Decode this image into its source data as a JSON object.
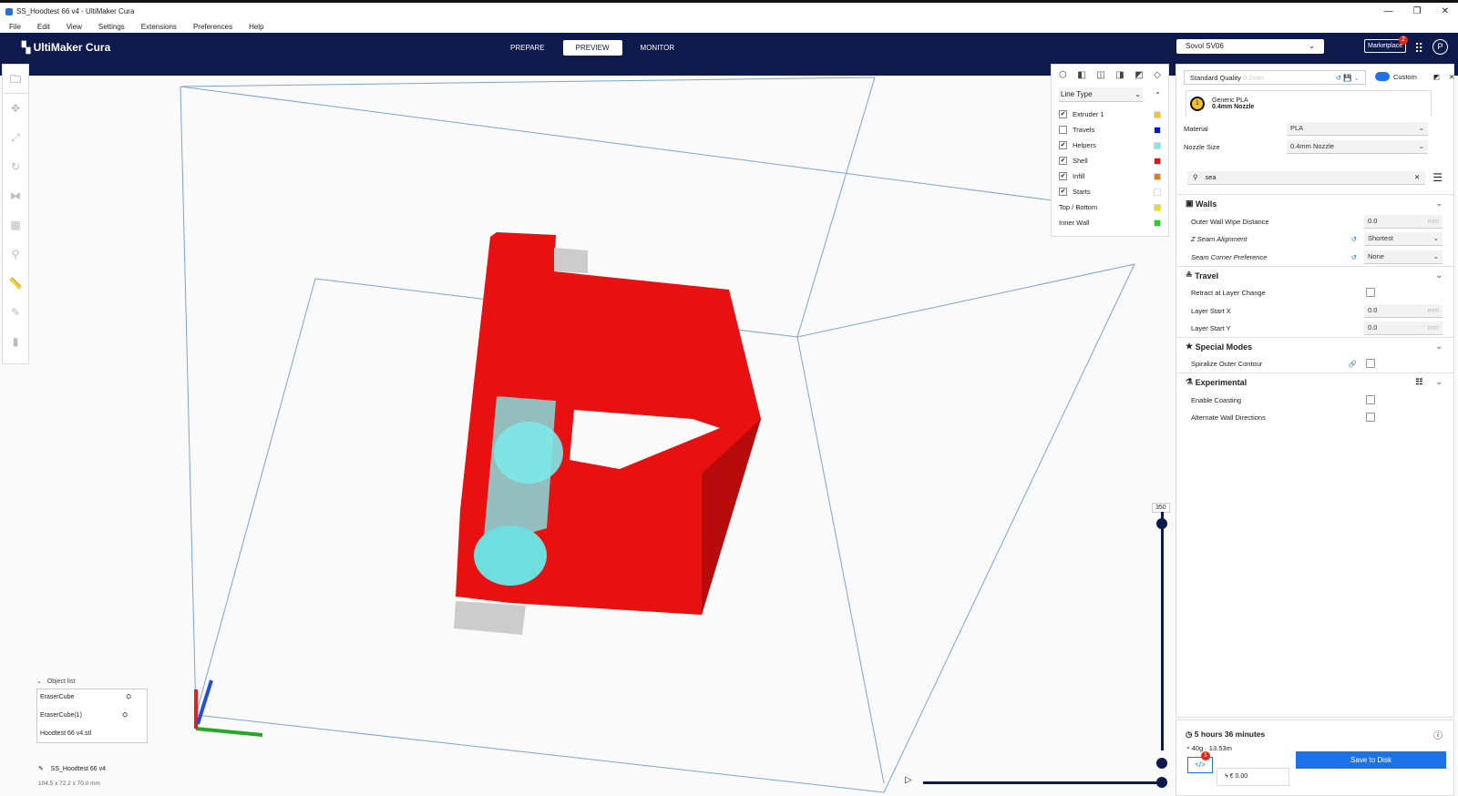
{
  "window": {
    "title": "SS_Hoodtest 66 v4 - UltiMaker Cura",
    "controls": [
      "—",
      "❐",
      "✕"
    ]
  },
  "menu": [
    "File",
    "Edit",
    "View",
    "Settings",
    "Extensions",
    "Preferences",
    "Help"
  ],
  "app": {
    "logo": "UltiMaker Cura",
    "tabs": [
      "PREPARE",
      "PREVIEW",
      "MONITOR"
    ],
    "active_tab": "PREVIEW",
    "printer": "Sovol SV06",
    "marketplace": "Marketplace",
    "marketplace_badge": "2",
    "avatar": "P"
  },
  "legend": {
    "view_type": "Line Type",
    "items": [
      {
        "label": "Extruder 1",
        "checked": true,
        "color": "#f5c12f"
      },
      {
        "label": "Travels",
        "checked": false,
        "color": "#0a14d8"
      },
      {
        "label": "Helpers",
        "checked": true,
        "color": "#7ee8e8"
      },
      {
        "label": "Shell",
        "checked": true,
        "color": "#e81010"
      },
      {
        "label": "Infill",
        "checked": true,
        "color": "#e87a10"
      },
      {
        "label": "Starts",
        "checked": true,
        "color": "#ffffff"
      },
      {
        "label": "Top / Bottom",
        "checked": null,
        "color": "#e8e010"
      },
      {
        "label": "Inner Wall",
        "checked": null,
        "color": "#18d818"
      }
    ]
  },
  "settings": {
    "quality": "Standard Quality",
    "layer_height": "0.2mm",
    "custom": "Custom",
    "extruder_num": "1",
    "material_name": "Generic PLA",
    "nozzle_name": "0.4mm Nozzle",
    "material_label": "Material",
    "material": "PLA",
    "nozzle_label": "Nozzle Size",
    "nozzle": "0.4mm Nozzle",
    "search": "sea",
    "walls": {
      "title": "Walls",
      "outer_wipe_label": "Outer Wall Wipe Distance",
      "outer_wipe": "0.0",
      "unit": "mm",
      "z_seam_label": "Z Seam Alignment",
      "z_seam": "Shortest",
      "corner_label": "Seam Corner Preference",
      "corner": "None"
    },
    "travel": {
      "title": "Travel",
      "retract_label": "Retract at Layer Change",
      "start_x_label": "Layer Start X",
      "start_x": "0.0",
      "start_y_label": "Layer Start Y",
      "start_y": "0.0"
    },
    "special": {
      "title": "Special Modes",
      "spiralize_label": "Spiralize Outer Contour"
    },
    "experimental": {
      "title": "Experimental",
      "coasting_label": "Enable Coasting",
      "alternate_label": "Alternate Wall Directions"
    }
  },
  "summary": {
    "time": "5 hours 36 minutes",
    "material": "40g · 13.53m",
    "cost": "€ 0.00",
    "save": "Save to Disk",
    "gcode_badge": "1"
  },
  "objects": {
    "title": "Object list",
    "items": [
      "EraserCube",
      "EraserCube(1)",
      "Hoodtest 66 v4.stl"
    ],
    "project": "SS_Hoodtest 66 v4",
    "dims": "104.5 x 72.2 x 70.0 mm"
  },
  "layer_slider": {
    "max_label": "350"
  }
}
